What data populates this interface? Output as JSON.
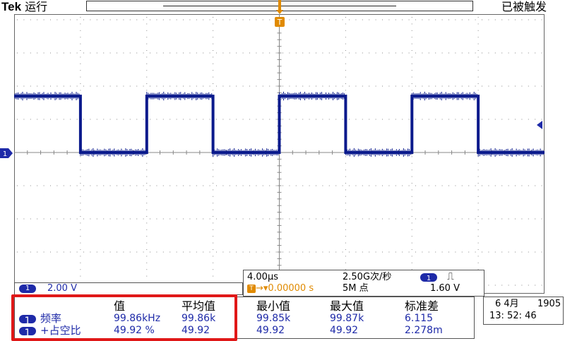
{
  "brand": {
    "name": "Tek",
    "run_status": "运行"
  },
  "trigger_status": "已被触发",
  "trigger_marker_label": "T",
  "channel_marker_label": "1",
  "colors": {
    "trace": "#0a1a8c",
    "accent_blue": "#1e2aa8",
    "trigger_orange": "#e08a00",
    "highlight_red": "#e01818"
  },
  "channel_panel": {
    "channel": "1",
    "volts_per_div": "2.00 V"
  },
  "timebase_panel": {
    "time_per_div": "4.00µs",
    "sample_rate": "2.50G次/秒",
    "trigger_channel": "1",
    "trigger_slope_icon": "rising-edge-icon",
    "trigger_slope_glyph": "⎍",
    "trigger_level": "1.60 V",
    "trigger_position": "0.00000 s",
    "record_length": "5M 点"
  },
  "measurements": {
    "headers": [
      "值",
      "平均值",
      "最小值",
      "最大值",
      "标准差"
    ],
    "rows": [
      {
        "channel": "1",
        "name": "频率",
        "value": "99.86kHz",
        "mean": "99.86k",
        "min": "99.85k",
        "max": "99.87k",
        "std": "6.115"
      },
      {
        "channel": "1",
        "name": "+占空比",
        "value": "49.92 %",
        "mean": "49.92",
        "min": "49.92",
        "max": "49.92",
        "std": "2.278m"
      }
    ]
  },
  "datetime": {
    "date": "6 4月",
    "year": "1905",
    "time": "13: 52: 46"
  },
  "chart_data": {
    "type": "line",
    "series": [
      {
        "x_div": [
          0,
          1.0,
          1.0,
          2.0,
          2.0,
          3.0,
          3.0,
          4.0,
          4.0,
          5.0,
          5.0,
          6.0,
          6.0,
          7.0,
          7.0,
          8.0
        ],
        "y_div": [
          0.95,
          0.95,
          0,
          0,
          0.95,
          0.95,
          0,
          0,
          0.95,
          0.95,
          0,
          0,
          0.95,
          0.95,
          0,
          0
        ]
      }
    ],
    "x_divisions": 8,
    "y_divisions": 8,
    "grid": true
  }
}
